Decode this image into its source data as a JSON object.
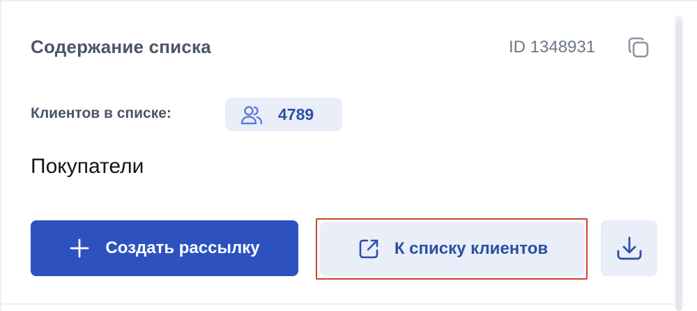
{
  "card": {
    "title": "Содержание списка",
    "id_label": "ID 1348931",
    "clients_label": "Клиентов в списке:",
    "clients_count": "4789",
    "list_name": "Покупатели"
  },
  "actions": {
    "create_mailing": "Создать рассылку",
    "to_clients_list": "К списку клиентов"
  },
  "icons": {
    "copy": "copy-icon",
    "users": "users-icon",
    "plus": "plus-icon",
    "external_link": "external-link-icon",
    "download": "download-icon"
  },
  "colors": {
    "primary": "#2d52c0",
    "primary_light_bg": "#e9eef9",
    "accent_text": "#2b4fa3",
    "highlight_border": "#d0412e"
  }
}
